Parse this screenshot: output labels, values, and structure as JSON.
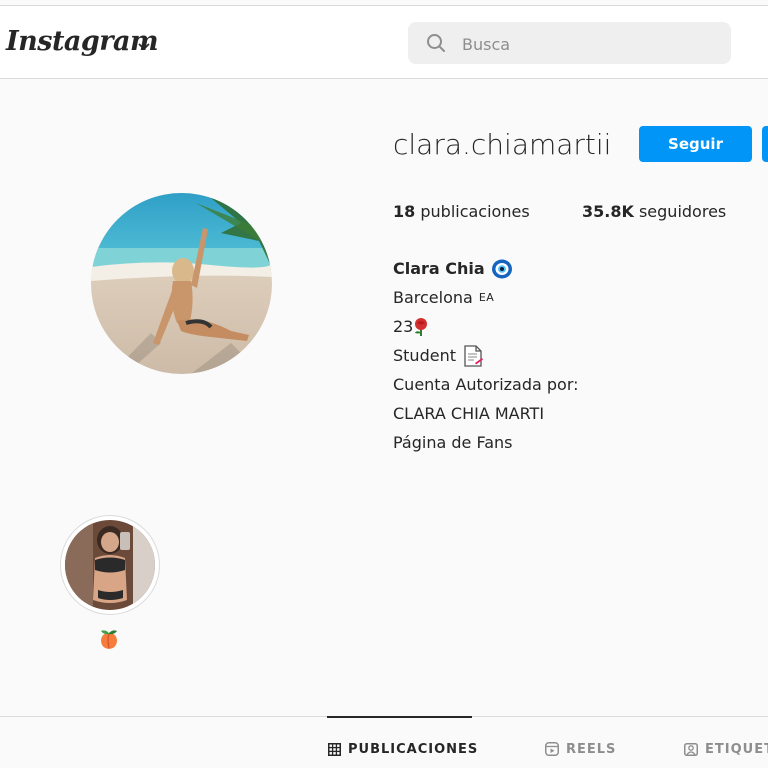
{
  "header": {
    "logo_text": "Instagram",
    "search_placeholder": "Busca"
  },
  "profile": {
    "username": "clara.chiamartii",
    "follow_label": "Seguir",
    "stats": {
      "posts_count": "18",
      "posts_label": "publicaciones",
      "followers_count": "35.8K",
      "followers_label": "seguidores"
    },
    "bio": {
      "full_name": "Clara Chia",
      "location": "Barcelona",
      "location_flag": "EA",
      "age": "23",
      "occupation": "Student",
      "line_authorized": "Cuenta Autorizada por:",
      "line_name": "CLARA CHIA MARTI",
      "line_fanpage": "Página de Fans"
    }
  },
  "highlights": [
    {
      "label_icon": "peach-emoji-icon"
    }
  ],
  "tabs": [
    {
      "label": "PUBLICACIONES",
      "icon": "grid-icon",
      "active": true
    },
    {
      "label": "REELS",
      "icon": "reels-icon",
      "active": false
    },
    {
      "label": "ETIQUET",
      "icon": "tagged-icon",
      "active": false
    }
  ],
  "colors": {
    "accent": "#0095f6",
    "background": "#fafafa",
    "text": "#262626",
    "secondary_text": "#8e8e8e",
    "border": "#dbdbdb"
  }
}
